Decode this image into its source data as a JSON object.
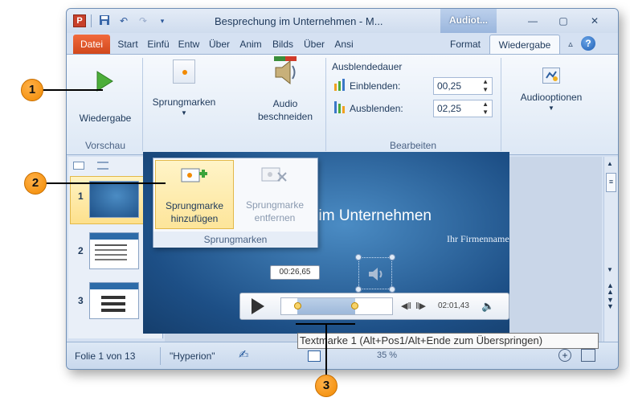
{
  "titlebar": {
    "app_icon": "P",
    "title": "Besprechung im Unternehmen - M...",
    "context_tab": "Audiot...",
    "minimize": "—",
    "maximize": "▢",
    "close": "✕"
  },
  "tabs": [
    "Datei",
    "Start",
    "Einfü",
    "Entw",
    "Über",
    "Anim",
    "Bilds",
    "Über",
    "Ansi",
    "Format",
    "Wiedergabe"
  ],
  "ribbon": {
    "play_label": "Wiedergabe",
    "sprungmarken_label": "Sprungmarken",
    "audio_trim_label_1": "Audio",
    "audio_trim_label_2": "beschneiden",
    "fade_header": "Ausblendedauer",
    "fade_in_label": "Einblenden:",
    "fade_in_value": "00,25",
    "fade_out_label": "Ausblenden:",
    "fade_out_value": "02,25",
    "audio_options_label": "Audiooptionen",
    "group_vorschau": "Vorschau",
    "group_bearbeiten": "Bearbeiten"
  },
  "gallery": {
    "add_label_1": "Sprungmarke",
    "add_label_2": "hinzufügen",
    "remove_label_1": "Sprungmarke",
    "remove_label_2": "entfernen",
    "group_label": "Sprungmarken"
  },
  "slides": {
    "numbers": [
      "1",
      "2",
      "3"
    ]
  },
  "slide": {
    "title": "prechung im Unternehmen",
    "subtitle": "Ihr Firmenname"
  },
  "player": {
    "bubble_time": "00:26,65",
    "time": "02:01,43"
  },
  "tooltip": "Textmarke 1 (Alt+Pos1/Alt+Ende zum Überspringen)",
  "status": {
    "slide_info": "Folie 1 von 13",
    "theme": "\"Hyperion\"",
    "zoom": "35 %"
  },
  "callouts": [
    "1",
    "2",
    "3"
  ],
  "colors": {
    "accent_orange": "#f28a00",
    "file_tab": "#d1481d",
    "play_green": "#4cae3a"
  }
}
